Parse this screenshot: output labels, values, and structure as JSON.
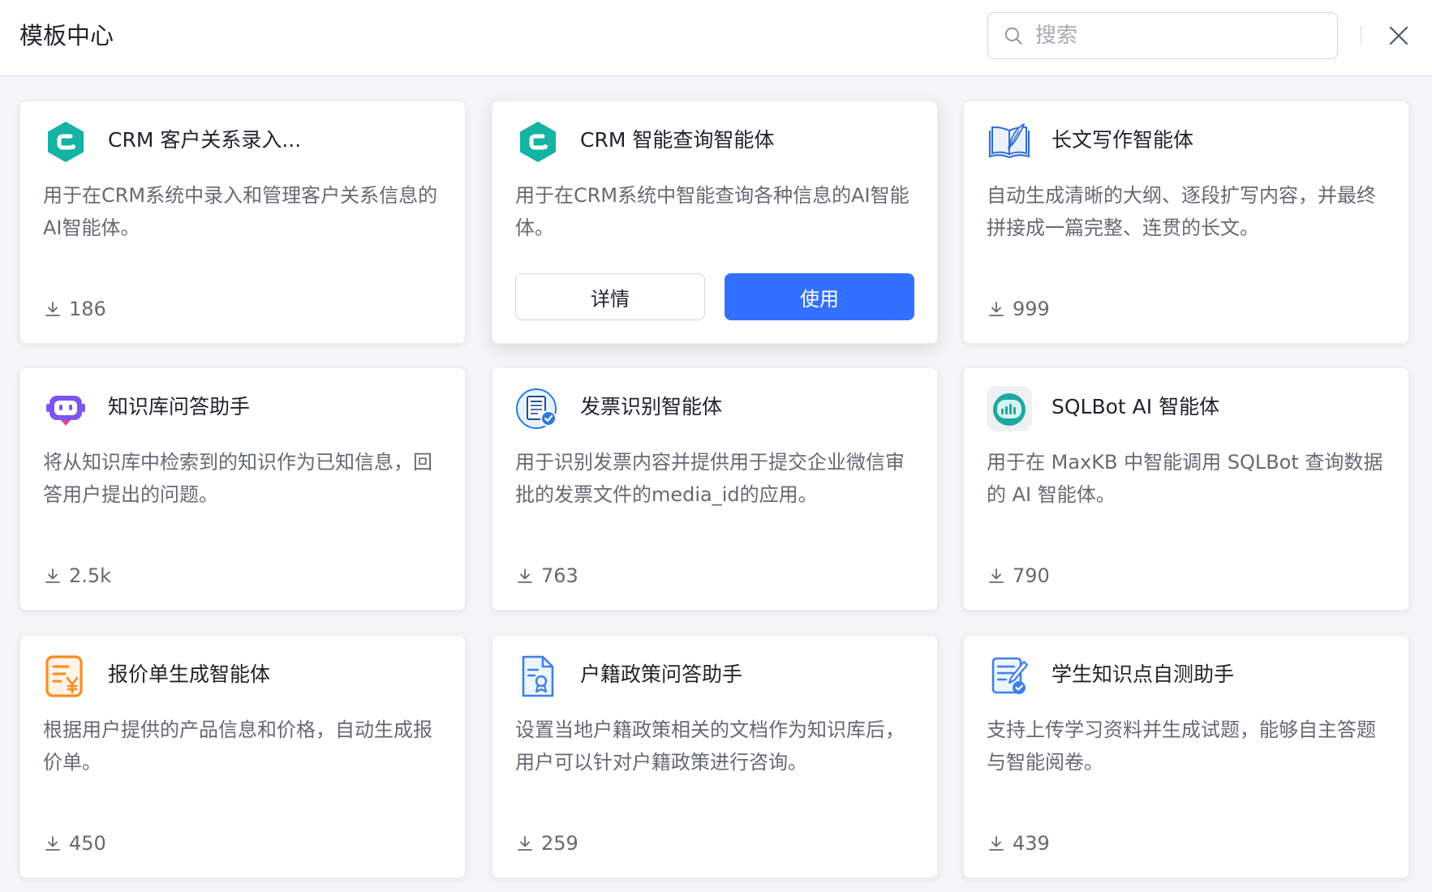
{
  "header": {
    "title": "模板中心",
    "search_placeholder": "搜索"
  },
  "colors": {
    "accent": "#3370ff",
    "crm_icon": "#14b3a3",
    "robot_icon": "#7b55f5",
    "quote_icon": "#ff8a1f",
    "doc_icon": "#3f7fe8"
  },
  "cards": [
    {
      "title": "CRM 客户关系录入...",
      "desc": "用于在CRM系统中录入和管理客户关系信息的AI智能体。",
      "downloads": "186",
      "icon": "crm-logo-icon"
    },
    {
      "title": "CRM 智能查询智能体",
      "desc": "用于在CRM系统中智能查询各种信息的AI智能体。",
      "downloads": "",
      "icon": "crm-logo-icon",
      "detail_label": "详情",
      "use_label": "使用"
    },
    {
      "title": "长文写作智能体",
      "desc": "自动生成清晰的大纲、逐段扩写内容，并最终拼接成一篇完整、连贯的长文。",
      "downloads": "999",
      "icon": "book-quill-icon"
    },
    {
      "title": "知识库问答助手",
      "desc": "将从知识库中检索到的知识作为已知信息，回答用户提出的问题。",
      "downloads": "2.5k",
      "icon": "robot-icon"
    },
    {
      "title": "发票识别智能体",
      "desc": "用于识别发票内容并提供用于提交企业微信审批的发票文件的media_id的应用。",
      "downloads": "763",
      "icon": "invoice-icon"
    },
    {
      "title": "SQLBot AI 智能体",
      "desc": "用于在 MaxKB 中智能调用 SQLBot 查询数据的 AI 智能体。",
      "downloads": "790",
      "icon": "sqlbot-icon"
    },
    {
      "title": "报价单生成智能体",
      "desc": "根据用户提供的产品信息和价格，自动生成报价单。",
      "downloads": "450",
      "icon": "quote-icon"
    },
    {
      "title": "户籍政策问答助手",
      "desc": "设置当地户籍政策相关的文档作为知识库后，用户可以针对户籍政策进行咨询。",
      "downloads": "259",
      "icon": "document-badge-icon"
    },
    {
      "title": "学生知识点自测助手",
      "desc": "支持上传学习资料并生成试题，能够自主答题与智能阅卷。",
      "downloads": "439",
      "icon": "checklist-icon"
    }
  ]
}
